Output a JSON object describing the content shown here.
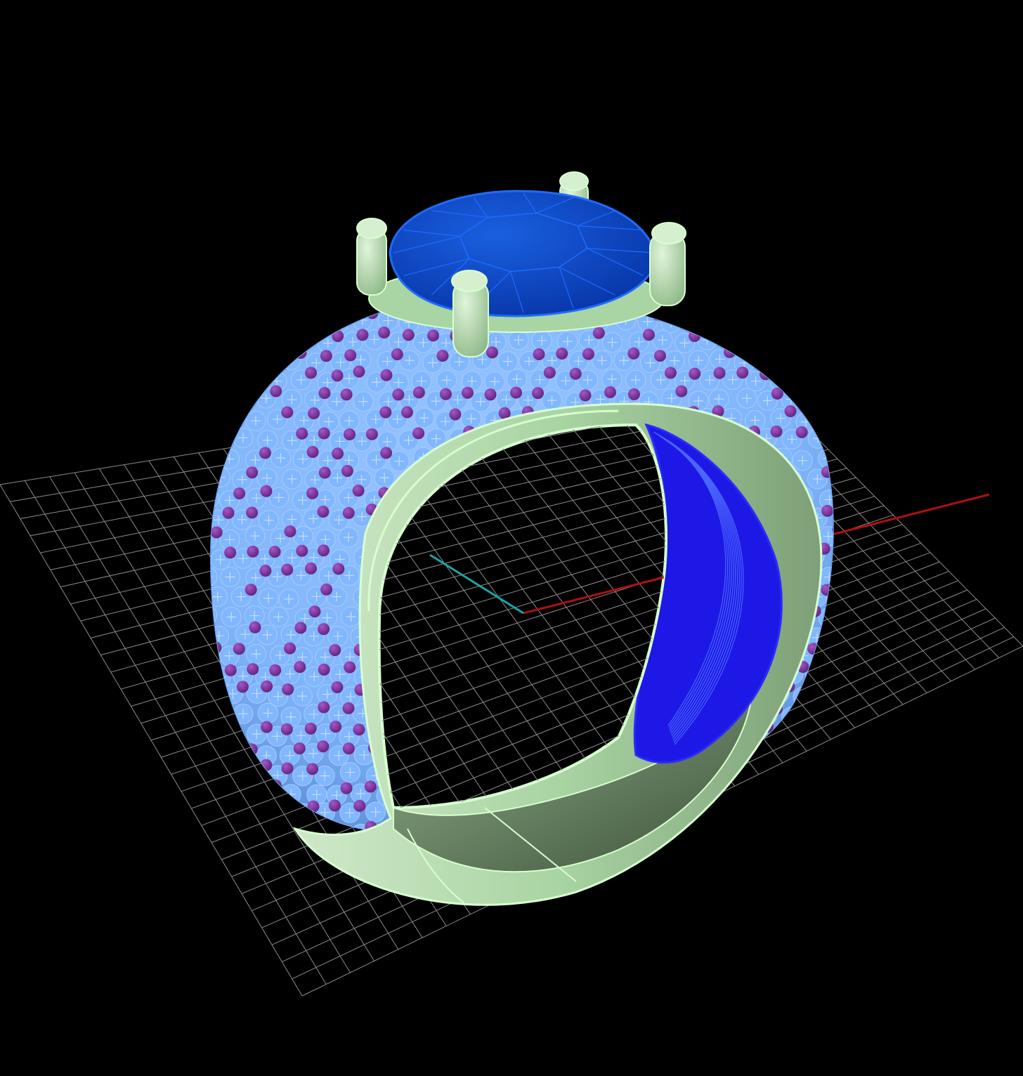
{
  "viewport": {
    "background": "#000000",
    "view": "perspective"
  },
  "grid": {
    "visible": true,
    "line_color": "#8c8c8c"
  },
  "axes": {
    "x_color": "#b01010",
    "y_color": "#1aa6a6"
  },
  "model": {
    "object": "ring",
    "center_stone": {
      "shape": "round",
      "color": "#0a3fbd",
      "edge_color": "#1e6bff"
    },
    "prongs": {
      "count": 4,
      "color": "#a9d4a3"
    },
    "band": {
      "color": "#a9d4a3",
      "edge_color": "#d8ffd0",
      "inner_color": "#5e7a5a"
    },
    "pave_seats": {
      "color": "#80b7ff"
    },
    "pave_beads": {
      "color": "#7a2d9a"
    },
    "inner_cutout": {
      "color": "#1d18e6"
    }
  }
}
